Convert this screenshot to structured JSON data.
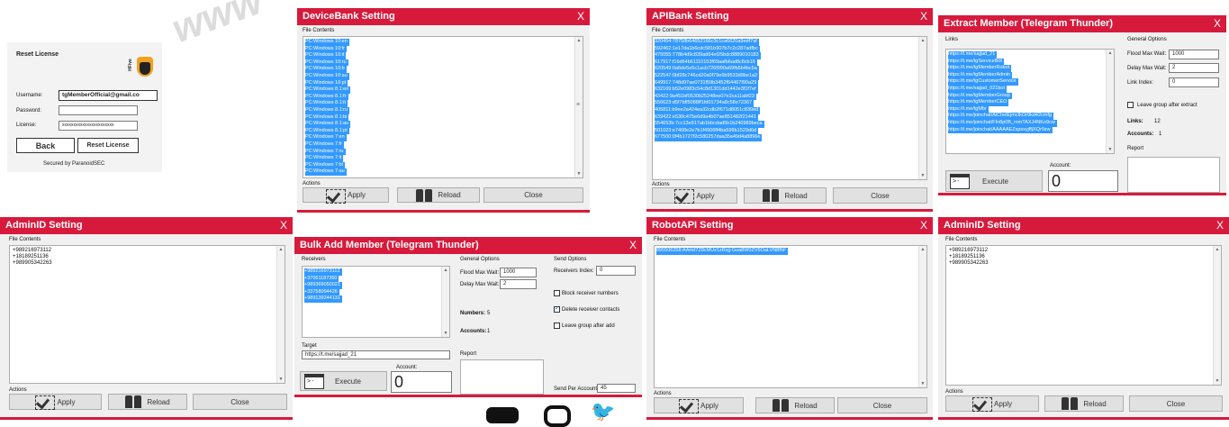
{
  "watermark": "www",
  "social_icons": [
    "youtube-icon",
    "instagram-icon",
    "twitter-icon"
  ],
  "reset": {
    "title": "Reset License",
    "logo": "HFive",
    "username_label": "Username:",
    "password_label": "Password:",
    "license_label": "License:",
    "username": "tgMemberOfficial@gmail.co",
    "password": "",
    "license": "xxxxxxxxxxxxxxxxxxxxxxx",
    "back": "Back",
    "reset_btn": "Reset License",
    "footer": "Secured by ParanoidSEC"
  },
  "common": {
    "file_contents": "File Contents",
    "actions": "Actions",
    "apply": "Apply",
    "reload": "Reload",
    "close": "Close",
    "close_x": "X",
    "execute": "Execute",
    "account": "Account:",
    "report": "Report",
    "general_options": "General Options",
    "flood": "Flood Max Wait:",
    "delay": "Delay Max Wait:"
  },
  "devicebank": {
    "title": "DeviceBank Setting",
    "lines": [
      "PC:Windows 10:en",
      "PC:Windows 10:fr",
      "PC:Windows 10:it",
      "PC:Windows 10:ru",
      "PC:Windows 10:b",
      "PC:Windows 10:au",
      "PC:Windows 10:pt",
      "PC:Windows 8.1:en",
      "PC:Windows 8.1:fr",
      "PC:Windows 8.1:it",
      "PC:Windows 8.1:ru",
      "PC:Windows 8.1:bi",
      "PC:Windows 8.1:au",
      "PC:Windows 8.1:pt",
      "PC:Windows 7:en",
      "PC:Windows 7:fr",
      "PC:Windows 7:ru",
      "PC:Windows 7:it",
      "PC:Windows 7:bi",
      "PC:Windows 7:au"
    ]
  },
  "apibank": {
    "title": "APIBank Setting",
    "lines": [
      "320454:78758b64652166c3c1ca6620a9edf7af",
      "592462:1e17da1b6cdc581b907b7c2c287adfbc",
      "475055:778b4d9c839ad64ef25bdc8889010183",
      "617917:f16d64b61110153f69aafb6ad8c8cb16",
      "620549:0a6de5e5c1acb726f990a69fb5b4bc5a",
      "522547:0bf28c746cd20a0f79e6b9533d9be1a2",
      "649917:748d97ae0731f59b3452f64467f90a29",
      "632169:b52e0983c54c8d1301dd1442e3f1f7ef",
      "43422:9a451bf0530b25248ee07e2ca11abf23",
      "556623:d5f7bff5088ff1fd01734a8c58e72367",
      "405811:b9ee2a424ea32cdb2f671d8051c839ed",
      "639422:e530c475e6d9a4b07ae851482f21441",
      "554653b:7cc13e917ab1bbcdad5b1b240989beca",
      "501023:e7408e2e7b1f4906ff4ba599b1529d6d",
      "677500:0f4b1727f2c580257daa35a49d4a8896e"
    ]
  },
  "extract": {
    "title": "Extract Member (Telegram Thunder)",
    "links_label": "Links",
    "links": [
      "https://t.me/sajjad_21",
      "https://t.me/tgServiceBot",
      "https://t.me/tgMemberRobot",
      "https://t.me/tgMemberAdmin",
      "https://t.me/tgCustomerService",
      "https://t.me/sajjad_021bot",
      "https://t.me/tgMemberGroup",
      "https://t.me/tgMemberCEO",
      "https://t.me/tgMbr",
      "https://t.me/joinchat/AlChelEjmcIkOr9kd42cmfg",
      "https://t.me/joinchat/FIn8p0B_mmTAXJ4NKo9cw",
      "https://t.me/joinchat/AAAAAEZxpsxyjffjXQr9zw"
    ],
    "flood_val": "1000",
    "delay_val": "2",
    "link_index_label": "Link Index:",
    "link_index_val": "0",
    "leave_label": "Leave group after extract",
    "links_count_label": "Links:",
    "links_count": "12",
    "accounts_label": "Accounts:",
    "accounts": "1",
    "account_val": "0"
  },
  "admin1": {
    "title": "AdminID Setting",
    "content": "+989216973112\n+18189251136\n+989905342263"
  },
  "bulk": {
    "title": "Bulk Add Member (Telegram Thunder)",
    "receivers_label": "Receivers",
    "receivers": [
      "+989216973112",
      "+37061187360",
      "+989369050021",
      "+33758094426",
      "+989139244131"
    ],
    "flood_val": "1000",
    "delay_val": "2",
    "numbers_label": "Numbers:",
    "numbers": "5",
    "accounts_label": "Accounts:",
    "accounts": "1",
    "send_options": "Send Options",
    "recv_index_label": "Receivers Index:",
    "recv_index": "0",
    "block_label": "Block receiver numbers",
    "delete_label": "Delete receiver contacts",
    "leave_label": "Leave group after add",
    "target_label": "Target",
    "target": "https://t.me/sajjad_21",
    "account_val": "0",
    "send_per_label": "Send Per Account:",
    "send_per": "45"
  },
  "robot": {
    "title": "RobotAPI Setting",
    "line": "895506258:AAHd7Z8cMUz1zRsjj-Gua8W0ZV5OaLVN8fhF"
  },
  "admin2": {
    "title": "AdminID Setting",
    "content": "+989216973112\n+18189251136\n+989905342263"
  }
}
